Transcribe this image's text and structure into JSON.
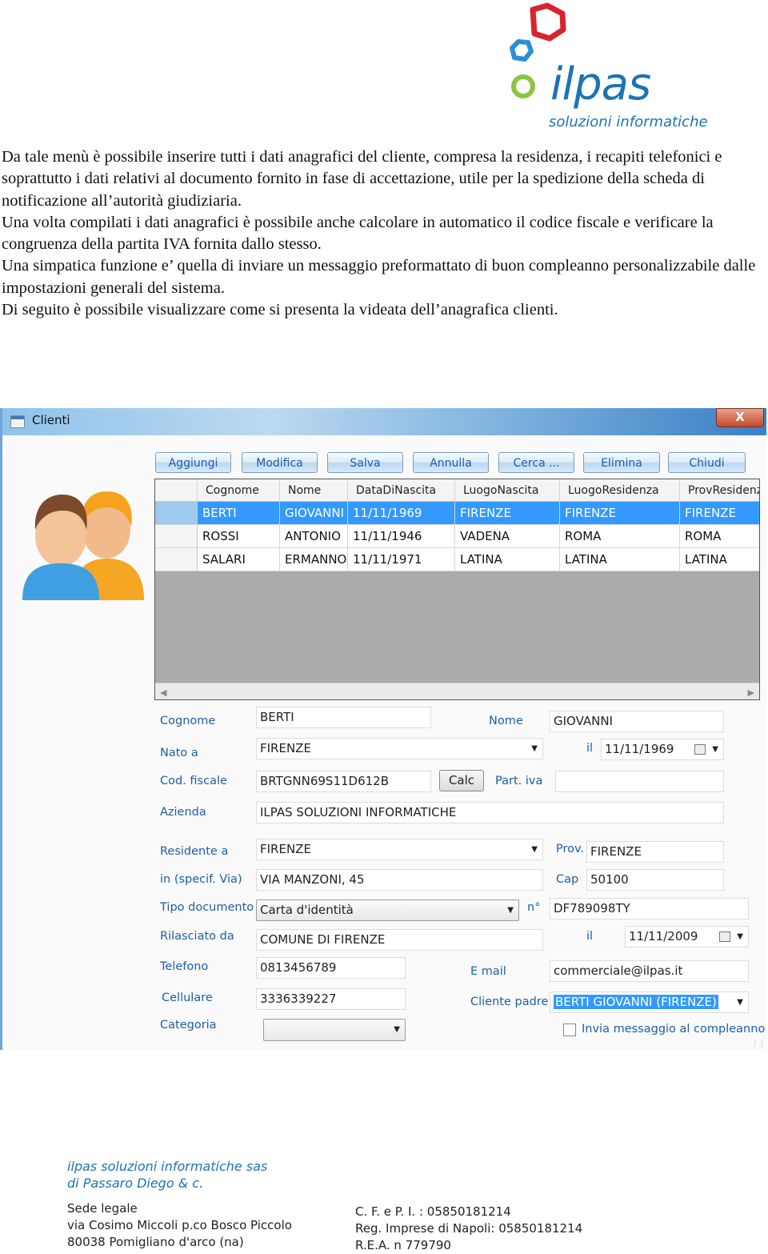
{
  "logo": {
    "word": "ilpas",
    "subtitle": "soluzioni informatiche"
  },
  "intro": [
    "Da tale menù è possibile inserire tutti i dati anagrafici del cliente, compresa la residenza, i recapiti telefonici e soprattutto i dati relativi al documento fornito in fase di accettazione, utile per la spedizione della scheda di notificazione all’autorità giudiziaria.",
    "Una volta compilati i dati anagrafici è possibile anche calcolare in automatico il codice fiscale e verificare la congruenza della partita IVA fornita dallo stesso.",
    "Una simpatica funzione e’ quella di inviare un messaggio preformattato di buon compleanno personalizzabile dalle impostazioni generali del sistema.",
    "Di seguito è possibile visualizzare come si presenta la videata dell’anagrafica clienti."
  ],
  "window": {
    "title": "Clienti",
    "close": "X"
  },
  "toolbar": {
    "add": "Aggiungi",
    "edit": "Modifica",
    "save": "Salva",
    "cancel": "Annulla",
    "search": "Cerca ...",
    "delete": "Elimina",
    "close": "Chiudi"
  },
  "grid": {
    "columns": [
      "Cognome",
      "Nome",
      "DataDiNascita",
      "LuogoNascita",
      "LuogoResidenza",
      "ProvResidenza"
    ],
    "rows": [
      [
        "BERTI",
        "GIOVANNI",
        "11/11/1969",
        "FIRENZE",
        "FIRENZE",
        "FIRENZE"
      ],
      [
        "ROSSI",
        "ANTONIO",
        "11/11/1946",
        "VADENA",
        "ROMA",
        "ROMA"
      ],
      [
        "SALARI",
        "ERMANNO",
        "11/11/1971",
        "LATINA",
        "LATINA",
        "LATINA"
      ]
    ],
    "selected_row": 0
  },
  "form": {
    "labels": {
      "cognome": "Cognome",
      "nome": "Nome",
      "nato_a": "Nato a",
      "il": "il",
      "cod_fiscale": "Cod. fiscale",
      "part_iva": "Part. iva",
      "azienda": "Azienda",
      "residente_a": "Residente a",
      "prov": "Prov.",
      "via": "in (specif. Via)",
      "cap": "Cap",
      "tipo_documento": "Tipo documento",
      "numero": "n°",
      "rilasciato_da": "Rilasciato da",
      "il_rilascio": "il",
      "telefono": "Telefono",
      "email": "E mail",
      "cellulare": "Cellulare",
      "cliente_padre": "Cliente padre",
      "categoria": "Categoria"
    },
    "values": {
      "cognome": "BERTI",
      "nome": "GIOVANNI",
      "nato_a": "FIRENZE",
      "data_nascita": "11/11/1969",
      "cod_fiscale": "BRTGNN69S11D612B",
      "part_iva": "",
      "azienda": "ILPAS SOLUZIONI INFORMATICHE",
      "residente_a": "FIRENZE",
      "prov": "FIRENZE",
      "via": "VIA MANZONI, 45",
      "cap": "50100",
      "tipo_documento": "Carta d'identità",
      "numero": "DF789098TY",
      "rilasciato_da": "COMUNE DI FIRENZE",
      "data_rilascio": "11/11/2009",
      "telefono": "0813456789",
      "email": "commerciale@ilpas.it",
      "cellulare": "3336339227",
      "cliente_padre": "BERTI GIOVANNI (FIRENZE)",
      "categoria": ""
    },
    "calc_button": "Calc",
    "birthday_checkbox": {
      "label": "Invia messaggio al compleanno",
      "checked": false
    }
  },
  "footer": {
    "company_line1": "ilpas soluzioni informatiche sas",
    "company_line2": "di Passaro Diego & c.",
    "legal_title": "Sede legale",
    "legal_address1": "via Cosimo Miccoli p.co Bosco Piccolo",
    "legal_address2": "80038 Pomigliano d'arco (na)",
    "cf_piva": "C. F. e P. I. : 05850181214",
    "reg_imprese": "Reg. Imprese di Napoli: 05850181214",
    "rea": "R.E.A. n 779790"
  },
  "colors": {
    "brand_blue": "#1d73b5",
    "brand_red": "#d9232e",
    "brand_green": "#8cc63f",
    "selection": "#3399ff"
  }
}
